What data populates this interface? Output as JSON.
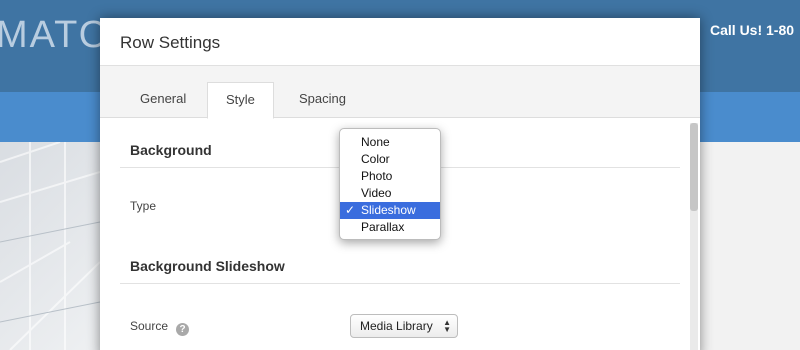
{
  "background_site": {
    "logo_text": "MATO",
    "phone_text": "Call Us! 1-80"
  },
  "modal": {
    "title": "Row Settings",
    "tabs": [
      {
        "label": "General"
      },
      {
        "label": "Style"
      },
      {
        "label": "Spacing"
      }
    ],
    "active_tab": "Style",
    "sections": [
      {
        "title": "Background",
        "fields": [
          {
            "label": "Type",
            "value": "Slideshow"
          }
        ]
      },
      {
        "title": "Background Slideshow",
        "fields": [
          {
            "label": "Source",
            "value": "Media Library",
            "has_help_icon": true
          }
        ]
      }
    ]
  },
  "dropdown": {
    "options": [
      "None",
      "Color",
      "Photo",
      "Video",
      "Slideshow",
      "Parallax"
    ],
    "selected": "Slideshow",
    "check_mark": "✓"
  },
  "colors": {
    "header_blue": "#3f74a3",
    "nav_blue": "#4a8ccd",
    "dropdown_highlight": "#3a6dde"
  }
}
